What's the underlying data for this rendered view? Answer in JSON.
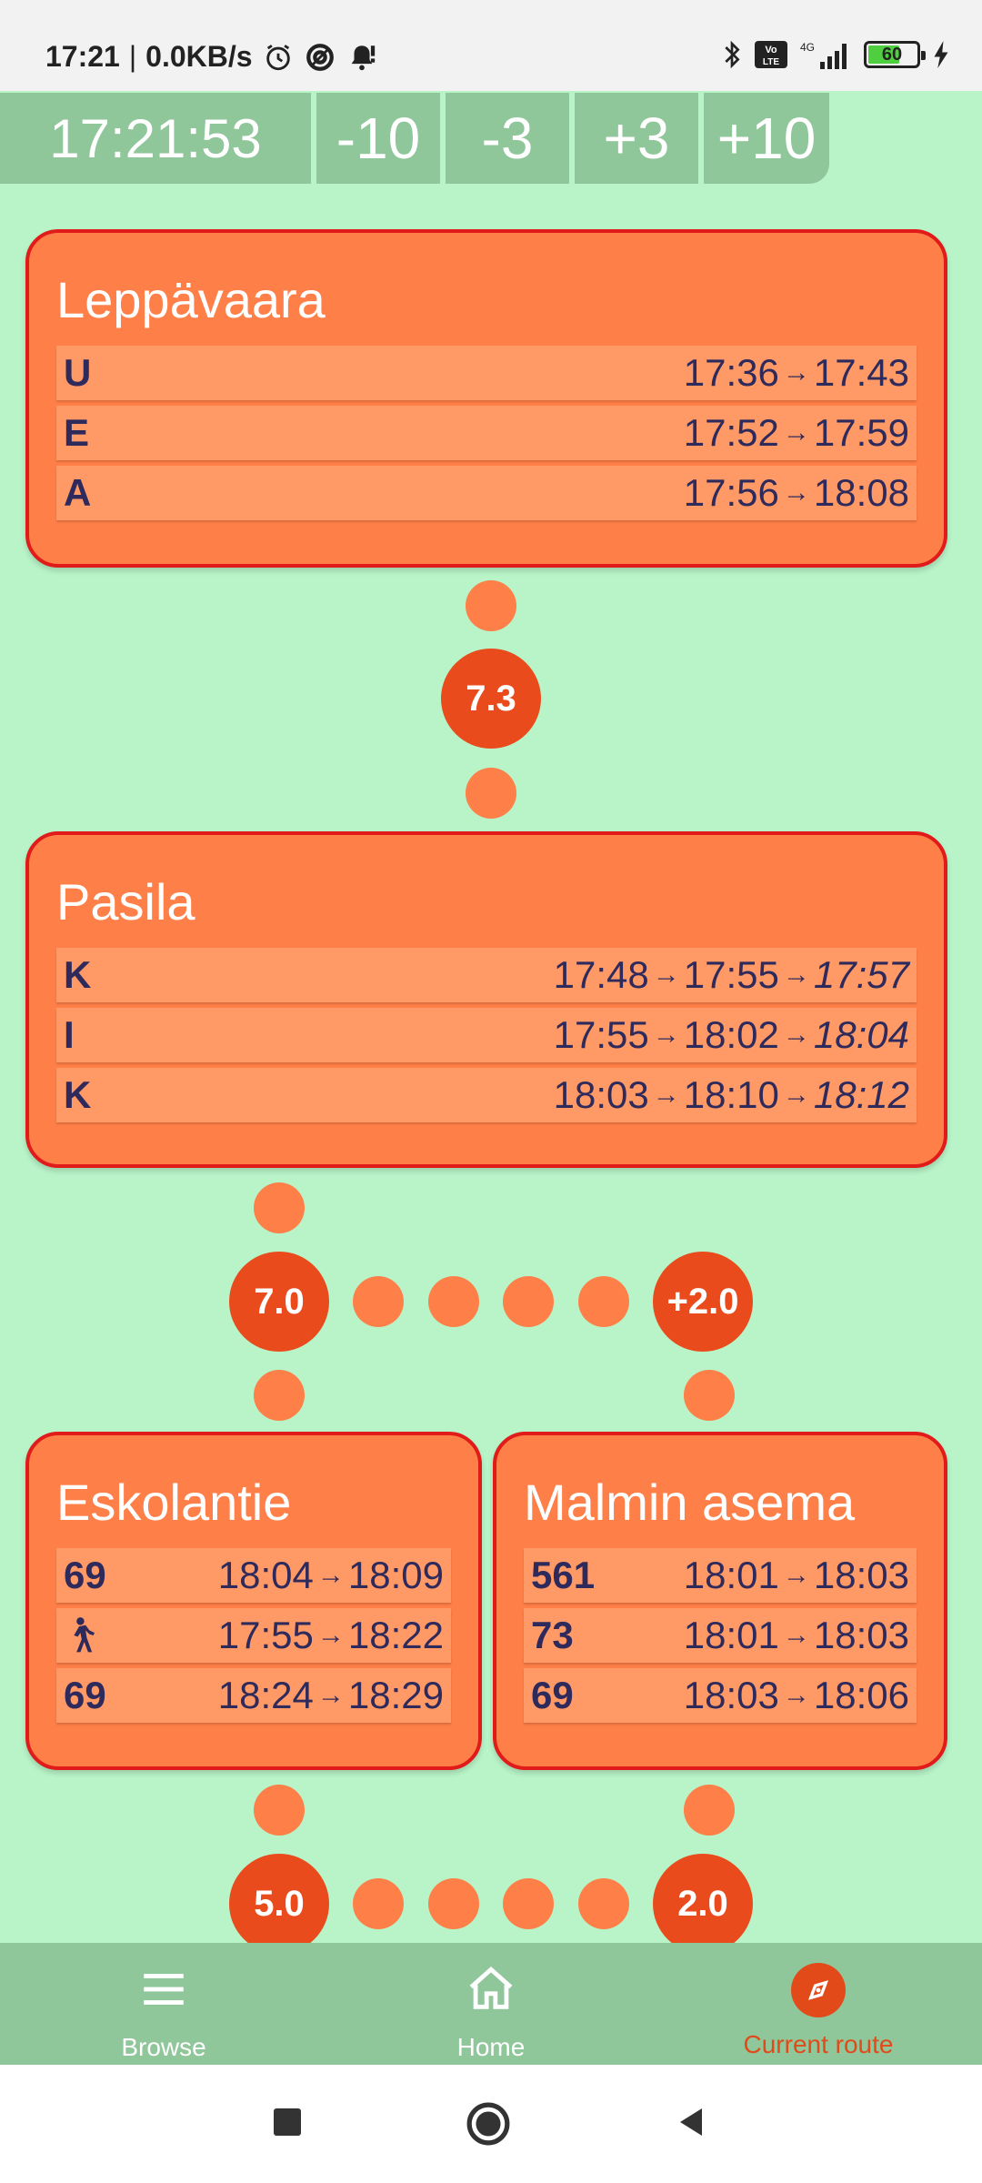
{
  "status_bar": {
    "time": "17:21",
    "network_speed": "0.0KB/s",
    "left_icons": [
      "alarm-icon",
      "data-saver-icon",
      "notification-alert-icon"
    ],
    "right_icons": [
      "bluetooth-icon",
      "volte-icon",
      "signal-4g-icon"
    ],
    "battery": "60"
  },
  "time_controls": {
    "clock": "17:21:53",
    "buttons": [
      "-10",
      "-3",
      "+3",
      "+10"
    ]
  },
  "stops": {
    "leppavaara": {
      "name": "Leppävaara",
      "rows": [
        {
          "line": "U",
          "t1": "17:36",
          "t2": "17:43"
        },
        {
          "line": "E",
          "t1": "17:52",
          "t2": "17:59"
        },
        {
          "line": "A",
          "t1": "17:56",
          "t2": "18:08"
        }
      ]
    },
    "pasila": {
      "name": "Pasila",
      "rows": [
        {
          "line": "K",
          "t1": "17:48",
          "t2": "17:55",
          "t3": "17:57"
        },
        {
          "line": "I",
          "t1": "17:55",
          "t2": "18:02",
          "t3": "18:04"
        },
        {
          "line": "K",
          "t1": "18:03",
          "t2": "18:10",
          "t3": "18:12"
        }
      ]
    },
    "eskolantie": {
      "name": "Eskolantie",
      "rows": [
        {
          "line": "69",
          "t1": "18:04",
          "t2": "18:09"
        },
        {
          "line": "walk-icon",
          "t1": "17:55",
          "t2": "18:22"
        },
        {
          "line": "69",
          "t1": "18:24",
          "t2": "18:29"
        }
      ]
    },
    "malmin_asema": {
      "name": "Malmin asema",
      "rows": [
        {
          "line": "561",
          "t1": "18:01",
          "t2": "18:03"
        },
        {
          "line": "73",
          "t1": "18:01",
          "t2": "18:03"
        },
        {
          "line": "69",
          "t1": "18:03",
          "t2": "18:06"
        }
      ]
    }
  },
  "durations": {
    "leppavaara_pasila": "7.3",
    "pasila_eskolantie": "7.0",
    "pasila_malmin_extra": "+2.0",
    "eskolantie_next": "5.0",
    "malmin_next": "2.0"
  },
  "arrow_glyph": "→",
  "bottom_nav": {
    "items": [
      {
        "label": "Browse",
        "icon": "menu-icon"
      },
      {
        "label": "Home",
        "icon": "home-icon"
      },
      {
        "label": "Current route",
        "icon": "compass-icon"
      }
    ],
    "active_index": 2
  },
  "colors": {
    "background": "#b8f4c8",
    "card": "#ff7f48",
    "card_border": "#e11a1a",
    "row": "#ff9a66",
    "bubble": "#e94b1d",
    "nav": "#8fc69a",
    "active": "#e24a1a"
  }
}
